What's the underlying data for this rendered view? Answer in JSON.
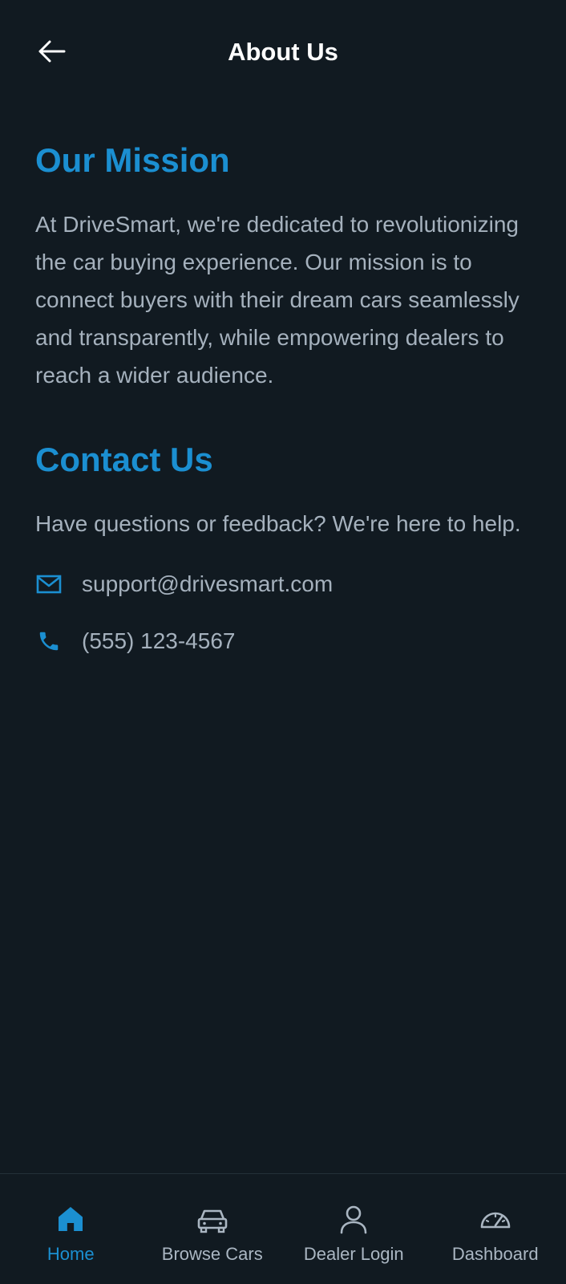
{
  "header": {
    "title": "About Us",
    "back_icon": "arrow-left-icon"
  },
  "mission": {
    "title": "Our Mission",
    "text": "At DriveSmart, we're dedicated to revolutionizing the car buying experience. Our mission is to connect buyers with their dream cars seamlessly and transparently, while empowering dealers to reach a wider audience."
  },
  "contact": {
    "title": "Contact Us",
    "text": "Have questions or feedback? We're here to help.",
    "email": {
      "icon": "mail-icon",
      "value": "support@drivesmart.com"
    },
    "phone": {
      "icon": "phone-icon",
      "value": "(555) 123-4567"
    }
  },
  "bottom_nav": {
    "items": [
      {
        "label": "Home",
        "icon": "home-icon",
        "active": true
      },
      {
        "label": "Browse Cars",
        "icon": "car-icon",
        "active": false
      },
      {
        "label": "Dealer Login",
        "icon": "user-icon",
        "active": false
      },
      {
        "label": "Dashboard",
        "icon": "speedometer-icon",
        "active": false
      }
    ]
  },
  "colors": {
    "background": "#111a21",
    "accent": "#1b8fd1",
    "text": "#a5b1bd",
    "title": "#ffffff"
  }
}
